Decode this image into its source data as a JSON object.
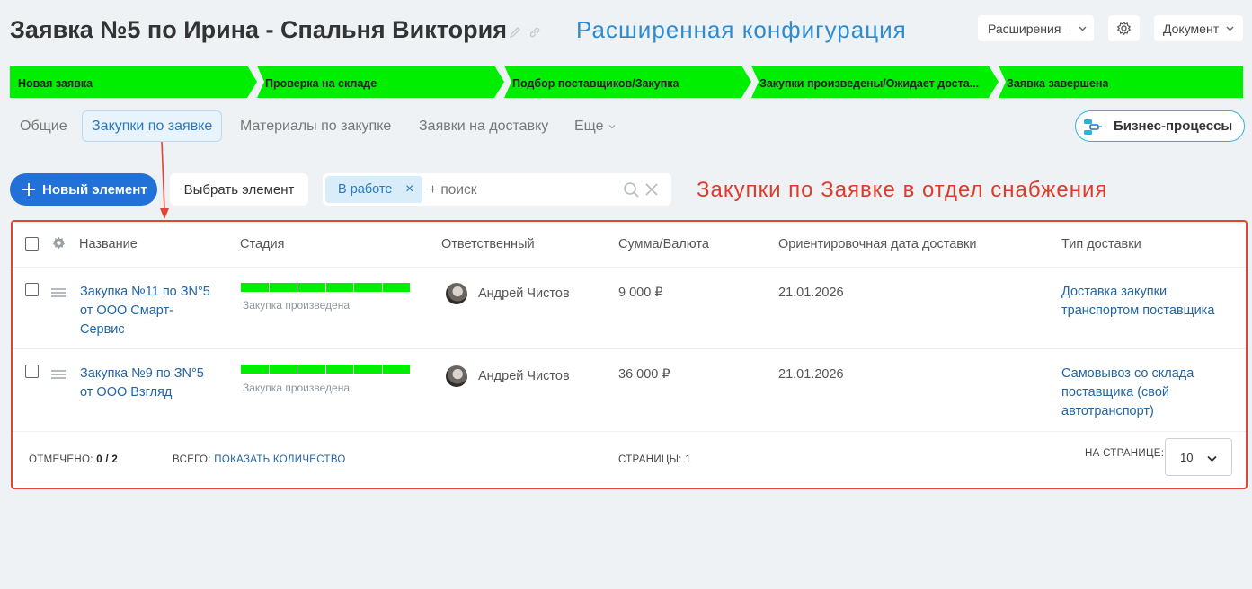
{
  "header": {
    "title": "Заявка №5 по Ирина - Спальня Виктория",
    "annotation": "Расширенная конфигурация",
    "extensions_label": "Расширения",
    "document_label": "Документ"
  },
  "colors": {
    "stage_green": "#00ee00",
    "accent_blue": "#2271d8",
    "annotation_red": "#e03a2a",
    "link_blue": "#2165a5"
  },
  "stages": [
    {
      "label": "Новая заявка"
    },
    {
      "label": "Проверка на складе"
    },
    {
      "label": "Подбор поставщиков/Закупка"
    },
    {
      "label": "Закупки произведены/Ожидает доста..."
    },
    {
      "label": "Заявка завершена"
    }
  ],
  "tabs": [
    {
      "label": "Общие"
    },
    {
      "label": "Закупки по заявке"
    },
    {
      "label": "Материалы по закупке"
    },
    {
      "label": "Заявки на доставку"
    },
    {
      "label": "Еще"
    }
  ],
  "business_processes_label": "Бизнес-процессы",
  "toolbar": {
    "new_label": "Новый элемент",
    "select_label": "Выбрать элемент",
    "filter_chip": "В работе",
    "search_placeholder": "+ поиск"
  },
  "annotation_red": "Закупки по Заявке в отдел снабжения",
  "table": {
    "columns": [
      "Название",
      "Стадия",
      "Ответственный",
      "Сумма/Валюта",
      "Ориентировочная дата доставки",
      "Тип доставки"
    ],
    "rows": [
      {
        "name": "Закупка №11 по ЗN°5 от ООО Смарт-Сервис",
        "stage": "Закупка произведена",
        "responsible": "Андрей Чистов",
        "amount": "9 000 ₽",
        "date": "21.01.2026",
        "delivery": "Доставка закупки транспортом поставщика"
      },
      {
        "name": "Закупка №9 по ЗN°5 от ООО Взгляд",
        "stage": "Закупка произведена",
        "responsible": "Андрей Чистов",
        "amount": "36 000 ₽",
        "date": "21.01.2026",
        "delivery": "Самовывоз со склада поставщика (свой автотранспорт)"
      }
    ]
  },
  "footer": {
    "checked_label": "ОТМЕЧЕНО:",
    "checked_value": "0 / 2",
    "total_label": "ВСЕГО:",
    "total_link": "ПОКАЗАТЬ КОЛИЧЕСТВО",
    "pages_label": "СТРАНИЦЫ:",
    "pages_value": "1",
    "per_page_label": "НА СТРАНИЦЕ:",
    "per_page_value": "10"
  }
}
